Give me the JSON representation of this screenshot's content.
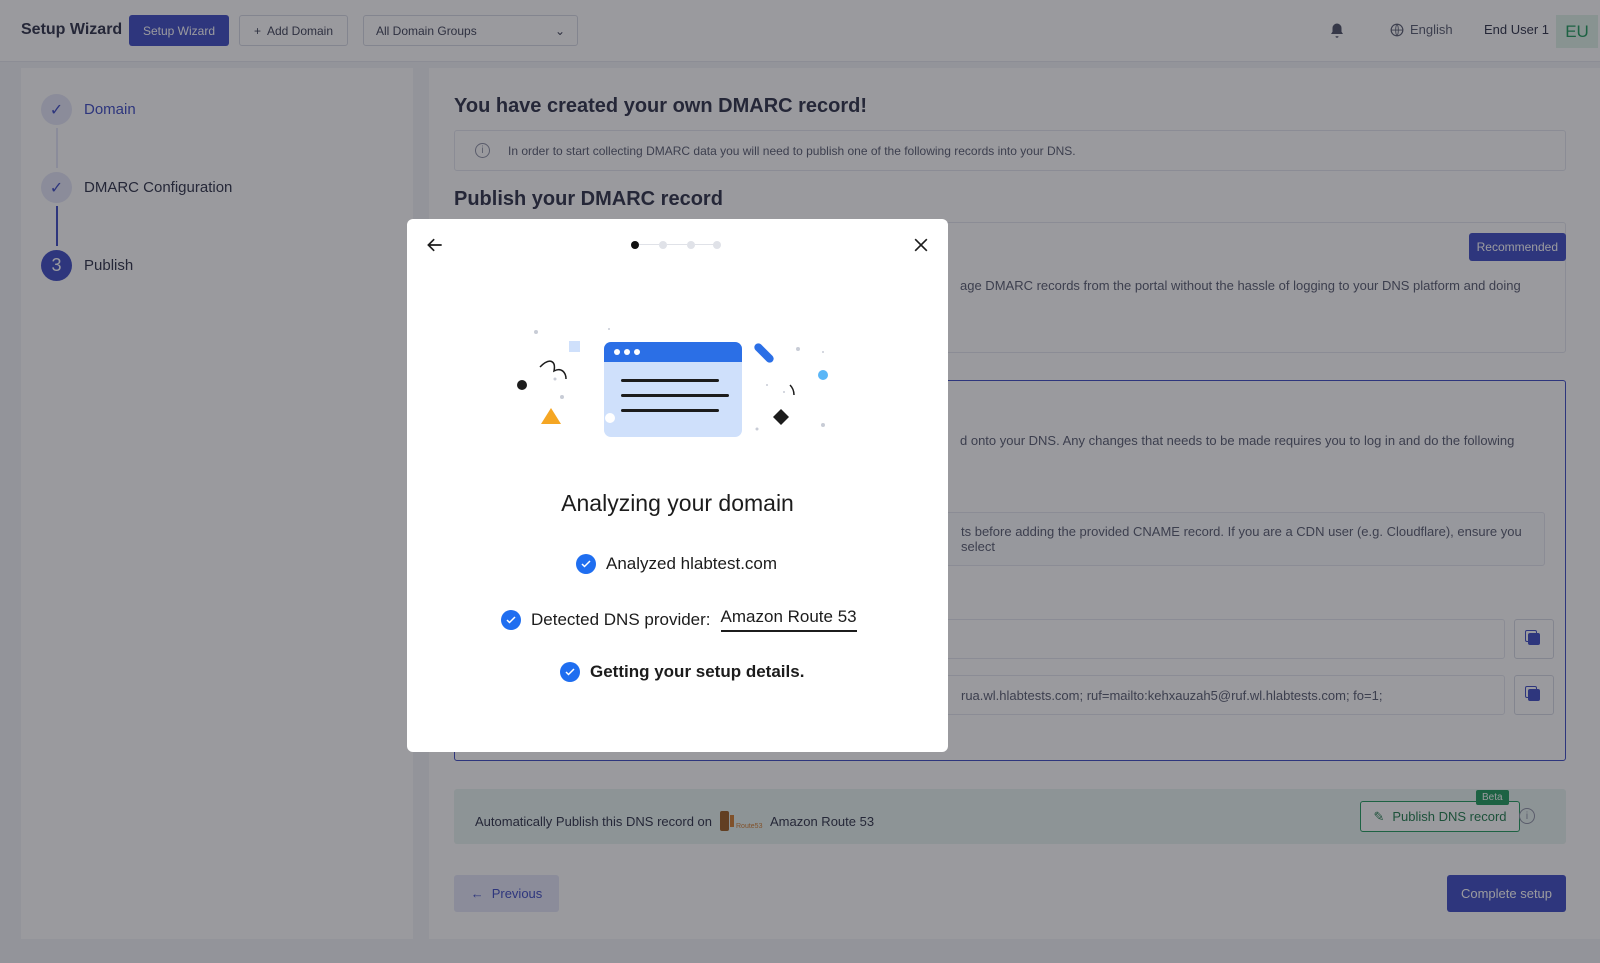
{
  "header": {
    "brand": "Setup Wizard",
    "wizard_button": "Setup Wizard",
    "add_domain": "Add Domain",
    "domain_groups": "All Domain Groups",
    "language": "English",
    "user_name": "End User 1",
    "avatar_initials": "EU"
  },
  "steps": [
    {
      "label": "Domain",
      "status": "done"
    },
    {
      "label": "DMARC Configuration",
      "status": "done"
    },
    {
      "label": "Publish",
      "status": "active",
      "number": "3"
    }
  ],
  "main": {
    "title": "You have created your own DMARC record!",
    "info": "In order to start collecting DMARC data you will need to publish one of the following records into your DNS.",
    "publish_title": "Publish your DMARC record",
    "recommended_badge": "Recommended",
    "option_text_partial": "age DMARC records from the portal without the hassle of logging to your DNS platform and doing",
    "cname_text_partial": "d onto your DNS. Any changes that needs to be made requires you to log in and do the following",
    "warning_text_partial": "ts before adding the provided CNAME record. If you are a CDN user (e.g. Cloudflare), ensure you select",
    "field_2_partial": "rua.wl.hlabtests.com; ruf=mailto:kehxauzah5@ruf.wl.hlabtests.com; fo=1;",
    "auto_publish_text": "Automatically Publish this DNS record on",
    "provider": "Amazon Route 53",
    "provider_logo_text": "Route53",
    "publish_button": "Publish DNS record",
    "beta_badge": "Beta",
    "previous_button": "Previous",
    "complete_button": "Complete setup"
  },
  "modal": {
    "title": "Analyzing your domain",
    "analyzed_label": "Analyzed hlabtest.com",
    "detected_label": "Detected DNS provider:",
    "detected_value": "Amazon Route 53",
    "getting_label": "Getting your setup details.",
    "progress_step": 1,
    "progress_total": 4
  },
  "colors": {
    "accent": "#3b49c4",
    "success": "#1c9a5a",
    "check_blue": "#1f6ef0",
    "illustration_blue": "#2b6fe6",
    "illustration_light": "#cfe0fb",
    "triangle_orange": "#f5a623"
  }
}
